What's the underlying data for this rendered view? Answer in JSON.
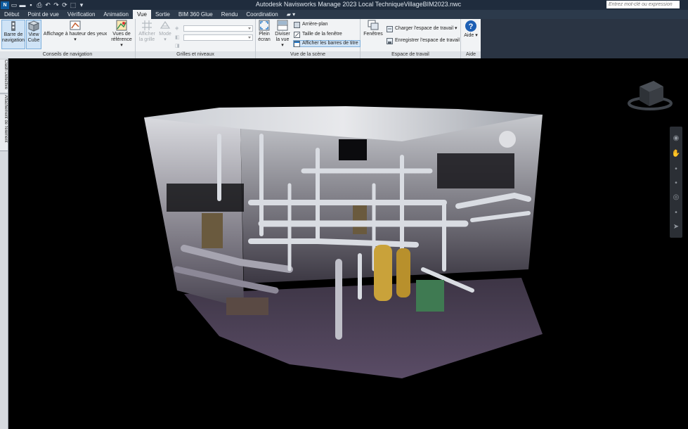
{
  "titlebar": {
    "app_button": "N",
    "title": "Autodesk Navisworks Manage 2023   Local TechniqueVillageBIM2023.nwc",
    "search_placeholder": "Entrez mot-clé ou expression"
  },
  "tabs": [
    "Début",
    "Point de vue",
    "Vérification",
    "Animation",
    "Vue",
    "Sortie",
    "BIM 360 Glue",
    "Rendu",
    "Coordination"
  ],
  "active_tab": "Vue",
  "ribbon": {
    "nav_aids": {
      "label": "Conseils de navigation",
      "nav_bar": "Barre de navigation",
      "view_cube": "View Cube",
      "hud": "Affichage à hauteur des yeux",
      "ref_views": "Vues de référence"
    },
    "grids": {
      "label": "Grilles et niveaux",
      "show_grid": "Afficher la grille",
      "mode": "Mode"
    },
    "scene_view": {
      "label": "Vue de la scène",
      "full_screen": "Plein écran",
      "split_view": "Diviser la vue",
      "background": "Arrière-plan",
      "window_size": "Taille de la fenêtre",
      "show_titlebars": "Afficher les barres de titre"
    },
    "workspace": {
      "label": "Espace de travail",
      "windows": "Fenêtres",
      "load_workspace": "Charger l'espace de travail",
      "save_workspace": "Enregistrer l'espace de travail"
    },
    "help": {
      "label": "Aide",
      "help_btn": "Aide"
    }
  },
  "side_tabs": [
    "Clash Detective",
    "Attachement de l'élément"
  ],
  "colors": {
    "titlebar": "#1f2c3d",
    "tabbar": "#2c3a4b",
    "ribbon": "#f1f3f5",
    "viewport": "#000000",
    "accent": "#1d76c9"
  }
}
